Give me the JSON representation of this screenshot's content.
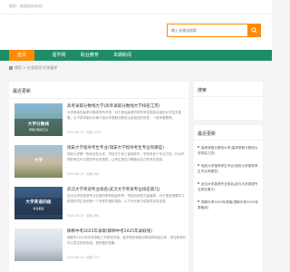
{
  "topbar": {
    "welcome": "您好，欢迎访问本站！"
  },
  "search": {
    "placeholder": "输入关键词搜索",
    "icon": "search-icon"
  },
  "nav": {
    "items": [
      "首页",
      "留学网",
      "职业教育",
      "本期新闻"
    ]
  },
  "breadcrumb": {
    "path": "首页 > 企业资讯·大学留学"
  },
  "main": {
    "section_title": "最近更新",
    "articles": [
      {
        "thumb_text": "大学分数线",
        "thumb_sub": "录取分数线汇总",
        "title": "高考录取分数线大学(高考录取分数线大学排名江苏)",
        "desc": "大学各地的高考分数线有所不同，对于参加高考的同学来说选择合适的大学至关重要，以下将详细为大家介绍大学录取分数线以及相关的信息，一起来看看吧。",
        "meta": "2023-06-15 · 阅读 (125)"
      },
      {
        "thumb_text": "大学",
        "thumb_sub": "",
        "title": "瑞安大学指导考生专业(瑞安大学指导考生专业有哪些)",
        "desc": "瑞安大学是一所综合性大学，学校位于浙江省瑞安市，学校有多个专业方向，针对不同的考生可以提供专业的指导，让考生更加了解适合自己的专业选择。",
        "meta": "2023-06-15 · 阅读 (98)"
      },
      {
        "thumb_text": "大学英语四级",
        "thumb_sub": "考试报名",
        "title": "武汉大学英语专业排名(武汉大学英语专业排名第几)",
        "desc": "武汉大学的英语专业在国内享有较高声誉，学校的师资力量雄厚，对于很多想要学习英语的学生来说是一个非常不错的选择，以下为大家介绍相关排名信息。",
        "meta": "2023-06-15 · 阅读 (86)"
      },
      {
        "thumb_text": "",
        "thumb_sub": "",
        "title": "邯郸中考2025年录取(邯郸中考2025年录取线)",
        "desc": "邯郸市2025年中考录取工作即将开始，各学校的录取分数线将陆续公布，考生和家长可以关注相关信息，提前做好准备。",
        "meta": "2023-06-15 · 阅读 (72)"
      }
    ]
  },
  "sidebar": {
    "search_title": "搜索",
    "recent_title": "最近更新",
    "recent": [
      "高考录取分数线大学(高考录取分数线大学排名江苏)",
      "瑞安大学指导考生专业(瑞安大学指导考生专业有哪些)",
      "武汉大学英语专业排名(武汉大学英语专业排名第几)",
      "邯郸中考2025年录取(邯郸中考2025年录取线)"
    ]
  },
  "colors": {
    "accent": "#ff8a00",
    "nav": "#1e8c66"
  }
}
